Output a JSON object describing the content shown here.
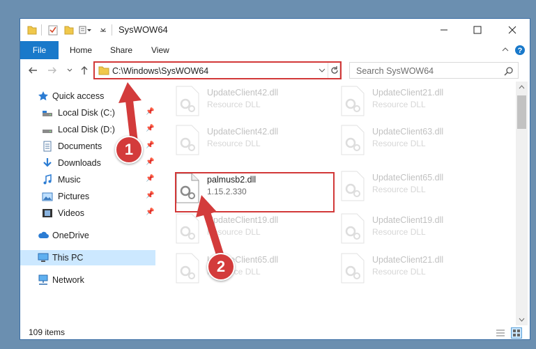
{
  "window": {
    "title": "SysWOW64"
  },
  "ribbon": {
    "tabs": [
      "File",
      "Home",
      "Share",
      "View"
    ]
  },
  "address": {
    "path": "C:\\Windows\\SysWOW64"
  },
  "search": {
    "placeholder": "Search SysWOW64"
  },
  "sidebar": {
    "items": [
      {
        "label": "Quick access",
        "icon": "star-icon"
      },
      {
        "label": "Local Disk (C:)",
        "icon": "drive-icon"
      },
      {
        "label": "Local Disk (D:)",
        "icon": "drive-icon"
      },
      {
        "label": "Documents",
        "icon": "documents-icon"
      },
      {
        "label": "Downloads",
        "icon": "download-icon"
      },
      {
        "label": "Music",
        "icon": "music-icon"
      },
      {
        "label": "Pictures",
        "icon": "pictures-icon"
      },
      {
        "label": "Videos",
        "icon": "videos-icon"
      },
      {
        "label": "OneDrive",
        "icon": "cloud-icon"
      },
      {
        "label": "This PC",
        "icon": "computer-icon"
      },
      {
        "label": "Network",
        "icon": "network-icon"
      }
    ]
  },
  "files": [
    {
      "name": "UpdateClient42.dll",
      "desc": "Resource DLL"
    },
    {
      "name": "UpdateClient21.dll",
      "desc": "Resource DLL"
    },
    {
      "name": "UpdateClient42.dll",
      "desc": "Resource DLL"
    },
    {
      "name": "UpdateClient63.dll",
      "desc": "Resource DLL"
    },
    {
      "name": "palmusb2.dll",
      "desc": "1.15.2.330"
    },
    {
      "name": "UpdateClient65.dll",
      "desc": "Resource DLL"
    },
    {
      "name": "UpdateClient19.dll",
      "desc": "Resource DLL"
    },
    {
      "name": "UpdateClient19.dll",
      "desc": "Resource DLL"
    },
    {
      "name": "UpdateClient65.dll",
      "desc": "Resource DLL"
    },
    {
      "name": "UpdateClient21.dll",
      "desc": "Resource DLL"
    }
  ],
  "status": {
    "count": "109 items"
  },
  "callouts": {
    "first": "1",
    "second": "2"
  },
  "colors": {
    "accent": "#1979ca",
    "highlight": "#d23838",
    "selected": "#cce8ff"
  }
}
